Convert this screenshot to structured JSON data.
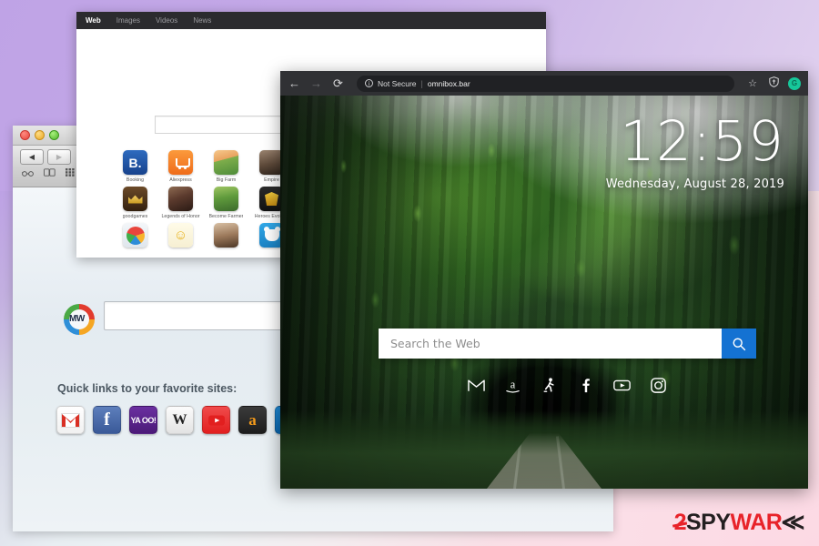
{
  "desktop": {
    "background_top_color": "#bfa3e6",
    "background_bottom_color": "#fcdfe7"
  },
  "window_portal": {
    "name": "search-portal-window",
    "titlebar": {
      "close_label": "",
      "minimize_label": "",
      "zoom_label": ""
    },
    "toolbar": {
      "back_label": "◀",
      "forward_label": "▶",
      "add_label": "+",
      "glasses_icon": "∞",
      "book_icon": "☷",
      "grid_icon": "▒"
    },
    "logo_text": "MW",
    "search": {
      "value": "",
      "placeholder": ""
    },
    "quicklinks_title": "Quick links to your favorite sites:",
    "quicklinks": [
      {
        "name": "gmail",
        "label": "M"
      },
      {
        "name": "facebook",
        "label": "f"
      },
      {
        "name": "yahoo",
        "label": "YA OO!"
      },
      {
        "name": "wikipedia",
        "label": "W"
      },
      {
        "name": "youtube",
        "label": "▶"
      },
      {
        "name": "amazon",
        "label": "a"
      },
      {
        "name": "walmart",
        "label": "✳"
      }
    ]
  },
  "window_results": {
    "name": "search-results-window",
    "tabs": [
      {
        "label": "Web",
        "active": true
      },
      {
        "label": "Images",
        "active": false
      },
      {
        "label": "Videos",
        "active": false
      },
      {
        "label": "News",
        "active": false
      }
    ],
    "search": {
      "value": "",
      "placeholder": ""
    },
    "tiles": [
      {
        "label": "Booking",
        "glyph": "B."
      },
      {
        "label": "Aliexpress",
        "glyph": ""
      },
      {
        "label": "Big Farm",
        "glyph": ""
      },
      {
        "label": "Empire",
        "glyph": ""
      },
      {
        "label": "goodgames",
        "glyph": ""
      },
      {
        "label": "Legends of Honor",
        "glyph": ""
      },
      {
        "label": "Become Farmer",
        "glyph": ""
      },
      {
        "label": "Heroes Evolved",
        "glyph": ""
      },
      {
        "label": "",
        "glyph": ""
      },
      {
        "label": "",
        "glyph": ""
      },
      {
        "label": "",
        "glyph": ""
      },
      {
        "label": "",
        "glyph": ""
      }
    ]
  },
  "window_chrome": {
    "name": "chrome-browser-window",
    "toolbar": {
      "back_label": "←",
      "forward_label": "→",
      "reload_label": "⟳",
      "info_label": "i",
      "security_text": "Not Secure",
      "separator": "|",
      "url": "omnibox.bar",
      "bookmark_icon": "☆",
      "shield_icon": "⛉",
      "avatar_label": "G"
    },
    "clock": {
      "time": "12:59",
      "date": "Wednesday, August 28, 2019"
    },
    "search": {
      "value": "",
      "placeholder": "Search the Web",
      "button_icon": "search-icon",
      "button_color": "#1472d2"
    },
    "shortcuts": [
      {
        "name": "gmail-icon",
        "title": "Gmail"
      },
      {
        "name": "amazon-icon",
        "title": "Amazon"
      },
      {
        "name": "walking-person-icon",
        "title": "Sports"
      },
      {
        "name": "facebook-icon",
        "title": "Facebook"
      },
      {
        "name": "youtube-icon",
        "title": "YouTube"
      },
      {
        "name": "instagram-icon",
        "title": "Instagram"
      }
    ]
  },
  "watermark": {
    "part_2": "2",
    "part_spy": "SPY",
    "part_war": "WAR",
    "part_e": "≪",
    "red": "#e8232a",
    "dark": "#231f20"
  }
}
